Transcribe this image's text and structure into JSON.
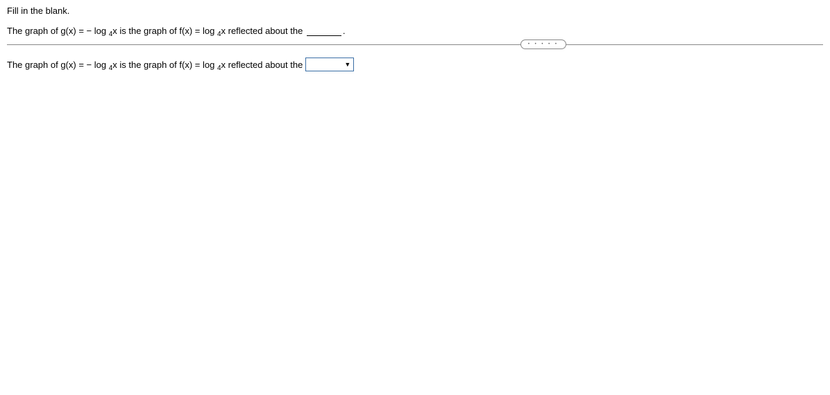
{
  "instruction": "Fill in the blank.",
  "question": {
    "pre1": "The graph of g(x) = − ",
    "log": "log ",
    "sub": "4",
    "post1": "x is the graph of f(x) = ",
    "log2": "log ",
    "sub2": "4",
    "post2": "x reflected about the ",
    "period": "."
  },
  "answer": {
    "pre1": "The graph of g(x) = − ",
    "log": "log ",
    "sub": "4",
    "post1": "x is the graph of f(x) = ",
    "log2": "log ",
    "sub2": "4",
    "post2": "x reflected about the"
  },
  "pill": "• • • • •",
  "chev": "▼"
}
